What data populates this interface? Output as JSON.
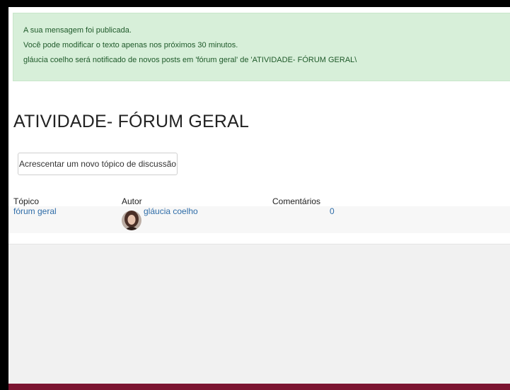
{
  "alert": {
    "line1": "A sua mensagem foi publicada.",
    "line2": "Você pode modificar o texto apenas nos próximos 30 minutos.",
    "line3": "gláucia coelho será notificado de novos posts em 'fórum geral' de 'ATIVIDADE- FÓRUM GERAL\\"
  },
  "page_title": "ATIVIDADE- FÓRUM GERAL",
  "add_topic_button": "Acrescentar um novo tópico de discussão",
  "table": {
    "headers": [
      "Tópico",
      "Autor",
      "Comentários"
    ],
    "rows": [
      {
        "topic": "fórum geral",
        "author": "gláucia coelho",
        "comments": "0"
      }
    ]
  },
  "colors": {
    "alert_bg": "#d7efd9",
    "link": "#2f6da8",
    "footer": "#7b1531"
  }
}
